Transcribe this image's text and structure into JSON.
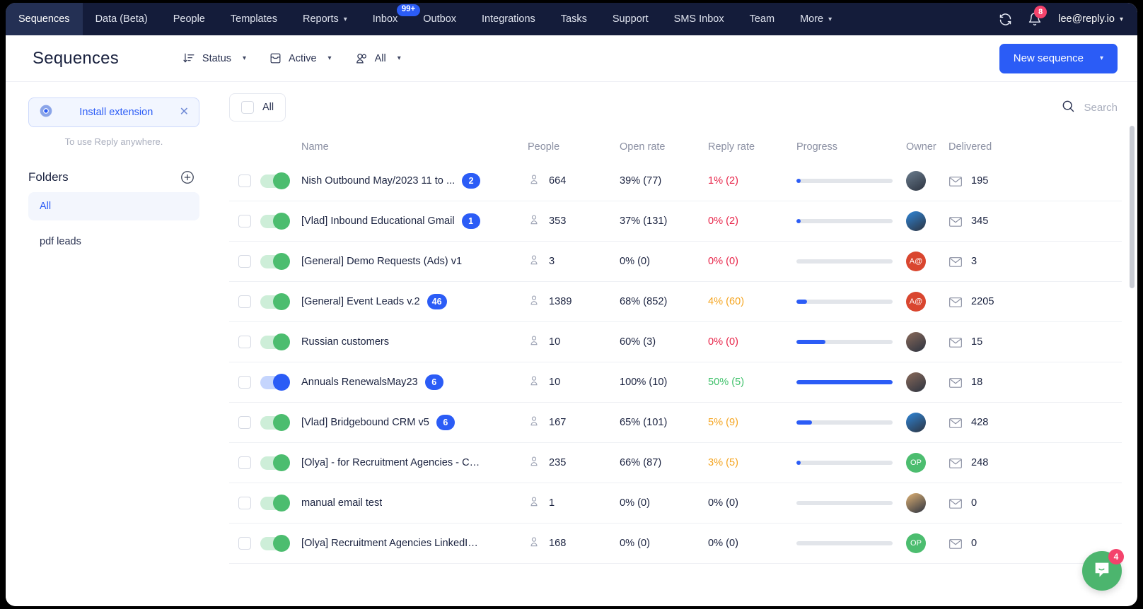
{
  "topnav": {
    "items": [
      {
        "label": "Sequences",
        "active": true,
        "caret": false
      },
      {
        "label": "Data (Beta)",
        "active": false,
        "caret": false
      },
      {
        "label": "People",
        "active": false,
        "caret": false
      },
      {
        "label": "Templates",
        "active": false,
        "caret": false
      },
      {
        "label": "Reports",
        "active": false,
        "caret": true
      },
      {
        "label": "Inbox",
        "active": false,
        "caret": false,
        "badge": "99+"
      },
      {
        "label": "Outbox",
        "active": false,
        "caret": false
      },
      {
        "label": "Integrations",
        "active": false,
        "caret": false
      },
      {
        "label": "Tasks",
        "active": false,
        "caret": false
      },
      {
        "label": "Support",
        "active": false,
        "caret": false
      },
      {
        "label": "SMS Inbox",
        "active": false,
        "caret": false
      },
      {
        "label": "Team",
        "active": false,
        "caret": false
      },
      {
        "label": "More",
        "active": false,
        "caret": true
      }
    ],
    "sync_icon": "sync-icon",
    "bell_icon": "bell-icon",
    "bell_badge": "8",
    "user_email": "lee@reply.io"
  },
  "header": {
    "title": "Sequences",
    "filters": [
      {
        "label": "Status",
        "icon": "sort-icon"
      },
      {
        "label": "Active",
        "icon": "archive-icon"
      },
      {
        "label": "All",
        "icon": "people-icon"
      }
    ],
    "new_sequence_label": "New sequence"
  },
  "sidebar": {
    "extension_label": "Install extension",
    "extension_icon": "chrome-icon",
    "extension_close_icon": "close-icon",
    "extension_sub": "To use Reply anywhere.",
    "folders_title": "Folders",
    "add_folder_icon": "plus-circle-icon",
    "folders": [
      {
        "label": "All",
        "active": true
      },
      {
        "label": "pdf leads",
        "active": false
      }
    ]
  },
  "list": {
    "select_all_label": "All",
    "search_placeholder": "Search",
    "search_icon": "search-icon",
    "columns": [
      "Name",
      "People",
      "Open rate",
      "Reply rate",
      "Progress",
      "Owner",
      "Delivered"
    ],
    "rows": [
      {
        "name": "Nish Outbound May/2023 11 to ...",
        "steps": "2",
        "toggle": "green",
        "people": "664",
        "open_rate": "39% (77)",
        "open_color": "dark",
        "reply_rate": "1% (2)",
        "reply_color": "red",
        "progress": 3,
        "owner": {
          "type": "photo",
          "tone": "#6b7d8e",
          "initials": ""
        },
        "delivered": "195"
      },
      {
        "name": "[Vlad] Inbound Educational Gmail",
        "steps": "1",
        "toggle": "green",
        "people": "353",
        "open_rate": "37% (131)",
        "open_color": "dark",
        "reply_rate": "0% (2)",
        "reply_color": "red",
        "progress": 3,
        "owner": {
          "type": "photo",
          "tone": "#2f86d8",
          "initials": ""
        },
        "delivered": "345"
      },
      {
        "name": "[General] Demo Requests (Ads) v1",
        "steps": "",
        "toggle": "green",
        "people": "3",
        "open_rate": "0% (0)",
        "open_color": "dark",
        "reply_rate": "0% (0)",
        "reply_color": "red",
        "progress": 0,
        "owner": {
          "type": "initials",
          "tone": "#d9462f",
          "initials": "A@"
        },
        "delivered": "3"
      },
      {
        "name": "[General] Event Leads v.2",
        "steps": "46",
        "toggle": "green",
        "people": "1389",
        "open_rate": "68% (852)",
        "open_color": "dark",
        "reply_rate": "4% (60)",
        "reply_color": "orange",
        "progress": 11,
        "owner": {
          "type": "initials",
          "tone": "#d9462f",
          "initials": "A@"
        },
        "delivered": "2205"
      },
      {
        "name": "Russian customers",
        "steps": "",
        "toggle": "green",
        "people": "10",
        "open_rate": "60% (3)",
        "open_color": "dark",
        "reply_rate": "0% (0)",
        "reply_color": "red",
        "progress": 30,
        "owner": {
          "type": "photo",
          "tone": "#8a6a5a",
          "initials": ""
        },
        "delivered": "15"
      },
      {
        "name": "Annuals RenewalsMay23",
        "steps": "6",
        "toggle": "blue",
        "people": "10",
        "open_rate": "100% (10)",
        "open_color": "dark",
        "reply_rate": "50% (5)",
        "reply_color": "green",
        "progress": 100,
        "owner": {
          "type": "photo",
          "tone": "#8a6a5a",
          "initials": ""
        },
        "delivered": "18"
      },
      {
        "name": "[Vlad] Bridgebound CRM v5",
        "steps": "6",
        "toggle": "green",
        "people": "167",
        "open_rate": "65% (101)",
        "open_color": "dark",
        "reply_rate": "5% (9)",
        "reply_color": "orange",
        "progress": 16,
        "owner": {
          "type": "photo",
          "tone": "#2f86d8",
          "initials": ""
        },
        "delivered": "428"
      },
      {
        "name": "[Olya] - for Recruitment Agencies - Cold",
        "steps": "",
        "toggle": "green",
        "people": "235",
        "open_rate": "66% (87)",
        "open_color": "dark",
        "reply_rate": "3% (5)",
        "reply_color": "orange",
        "progress": 3,
        "owner": {
          "type": "initials",
          "tone": "#4cbd6f",
          "initials": "OP"
        },
        "delivered": "248"
      },
      {
        "name": "manual email test",
        "steps": "",
        "toggle": "green",
        "people": "1",
        "open_rate": "0% (0)",
        "open_color": "dark",
        "reply_rate": "0% (0)",
        "reply_color": "dark",
        "progress": 0,
        "owner": {
          "type": "photo",
          "tone": "#e0b274",
          "initials": ""
        },
        "delivered": "0"
      },
      {
        "name": "[Olya] Recruitment Agencies LinkedIn...",
        "steps": "",
        "toggle": "green",
        "people": "168",
        "open_rate": "0% (0)",
        "open_color": "dark",
        "reply_rate": "0% (0)",
        "reply_color": "dark",
        "progress": 0,
        "owner": {
          "type": "initials",
          "tone": "#4cbd6f",
          "initials": "OP"
        },
        "delivered": "0"
      }
    ]
  },
  "intercom": {
    "icon": "chat-bubble-icon",
    "badge": "4"
  },
  "colors": {
    "accent": "#2b5cf6",
    "navbar": "#141c3a",
    "danger": "#e8274b",
    "warning": "#f5a623",
    "success": "#3fc16a",
    "toggle_green": "#4cbd6f"
  }
}
